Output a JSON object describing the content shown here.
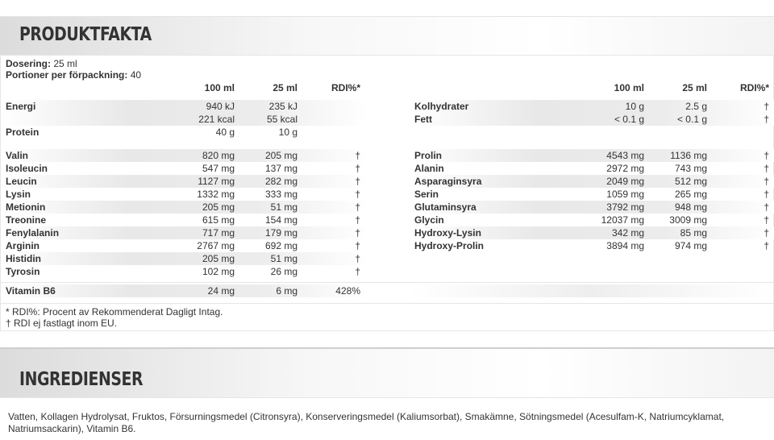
{
  "produktfakta": {
    "title": "PRODUKTFAKTA",
    "dosering_label": "Dosering:",
    "dosering_value": "25 ml",
    "portioner_label": "Portioner per förpackning:",
    "portioner_value": "40"
  },
  "left_table": {
    "headers": [
      "",
      "100 ml",
      "25 ml",
      "RDI%*"
    ],
    "rows": [
      [
        "Energi",
        "940 kJ",
        "235 kJ",
        ""
      ],
      [
        "",
        "221 kcal",
        "55 kcal",
        ""
      ],
      [
        "Protein",
        "40 g",
        "10 g",
        ""
      ],
      [
        "Valin",
        "820 mg",
        "205 mg",
        "†"
      ],
      [
        "Isoleucin",
        "547 mg",
        "137 mg",
        "†"
      ],
      [
        "Leucin",
        "1127 mg",
        "282 mg",
        "†"
      ],
      [
        "Lysin",
        "1332 mg",
        "333 mg",
        "†"
      ],
      [
        "Metionin",
        "205 mg",
        "51 mg",
        "†"
      ],
      [
        "Treonine",
        "615 mg",
        "154 mg",
        "†"
      ],
      [
        "Fenylalanin",
        "717 mg",
        "179 mg",
        "†"
      ],
      [
        "Arginin",
        "2767 mg",
        "692 mg",
        "†"
      ],
      [
        "Histidin",
        "205 mg",
        "51 mg",
        "†"
      ],
      [
        "Tyrosin",
        "102 mg",
        "26 mg",
        "†"
      ]
    ]
  },
  "right_table": {
    "headers": [
      "",
      "100 ml",
      "25 ml",
      "RDI%*"
    ],
    "rows": [
      [
        "Kolhydrater",
        "10 g",
        "2.5 g",
        "†"
      ],
      [
        "Fett",
        "< 0.1 g",
        "< 0.1 g",
        "†"
      ],
      [
        "Prolin",
        "4543 mg",
        "1136 mg",
        "†"
      ],
      [
        "Alanin",
        "2972 mg",
        "743 mg",
        "†"
      ],
      [
        "Asparaginsyra",
        "2049 mg",
        "512 mg",
        "†"
      ],
      [
        "Serin",
        "1059 mg",
        "265 mg",
        "†"
      ],
      [
        "Glutaminsyra",
        "3792 mg",
        "948 mg",
        "†"
      ],
      [
        "Glycin",
        "12037 mg",
        "3009 mg",
        "†"
      ],
      [
        "Hydroxy-Lysin",
        "342 mg",
        "85 mg",
        "†"
      ],
      [
        "Hydroxy-Prolin",
        "3894 mg",
        "974 mg",
        "†"
      ]
    ]
  },
  "vitamin_row": [
    "Vitamin B6",
    "24 mg",
    "6 mg",
    "428%"
  ],
  "footnotes": [
    "* RDI%: Procent av Rekommenderat Dagligt Intag.",
    "† RDI ej fastlagt inom EU."
  ],
  "ingredienser": {
    "title": "INGREDIENSER",
    "text": "Vatten, Kollagen Hydrolysat, Fruktos, Försurningsmedel (Citronsyra), Konserveringsmedel (Kaliumsorbat), Smakämne, Sötningsmedel (Acesulfam-K, Natriumcyklamat, Natriumsackarin), Vitamin B6."
  }
}
